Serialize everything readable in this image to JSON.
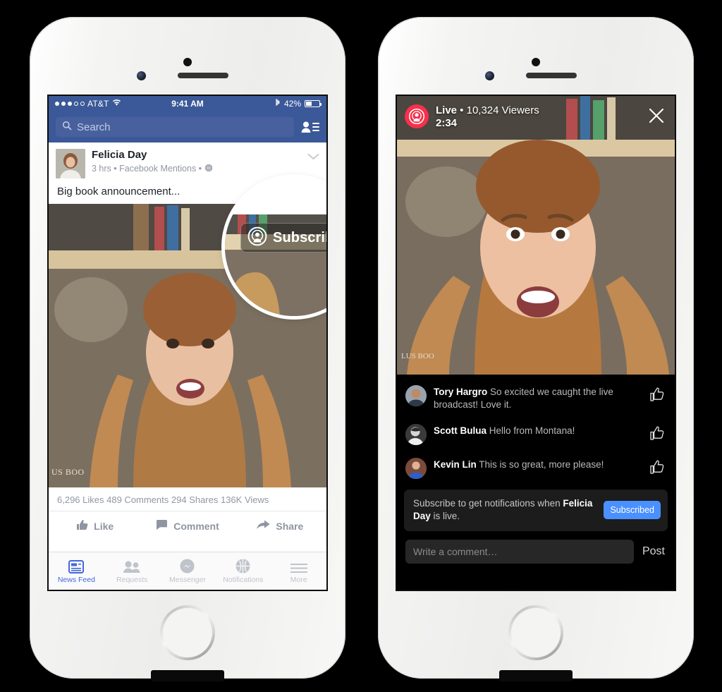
{
  "left_phone": {
    "status_bar": {
      "signal_dots_filled": 3,
      "signal_dots_total": 5,
      "carrier": "AT&T",
      "wifi_icon": "wifi-icon",
      "time": "9:41 AM",
      "bluetooth_icon": "bluetooth-icon",
      "battery_percent": "42%"
    },
    "nav": {
      "search_placeholder": "Search",
      "search_icon": "search-icon",
      "friend_requests_icon": "friend-list-icon"
    },
    "post": {
      "author": "Felicia Day",
      "meta": "3 hrs • Facebook Mentions •",
      "privacy_icon": "globe-icon",
      "menu_icon": "chevron-down-icon",
      "message": "Big book announcement...",
      "video_watermark": "US BOO"
    },
    "stats": "6,296 Likes  489 Comments  294 Shares  136K Views",
    "actions": [
      {
        "label": "Like",
        "icon": "thumbs-up-icon"
      },
      {
        "label": "Comment",
        "icon": "comment-bubble-icon"
      },
      {
        "label": "Share",
        "icon": "share-arrow-icon"
      }
    ],
    "tabs": [
      {
        "label": "News Feed",
        "icon": "news-feed-icon",
        "active": true
      },
      {
        "label": "Requests",
        "icon": "friend-requests-icon",
        "active": false
      },
      {
        "label": "Messenger",
        "icon": "messenger-icon",
        "active": false
      },
      {
        "label": "Notifications",
        "icon": "globe-notifications-icon",
        "active": false
      },
      {
        "label": "More",
        "icon": "hamburger-menu-icon",
        "active": false
      }
    ],
    "magnifier": {
      "button_label": "Subscribe",
      "button_icon": "live-broadcast-person-icon"
    }
  },
  "right_phone": {
    "live": {
      "badge_icon": "live-broadcast-person-icon",
      "status_line": "Live • 10,324 Viewers",
      "status_word": "Live",
      "viewers": "10,324 Viewers",
      "elapsed": "2:34",
      "close_icon": "close-icon"
    },
    "comments": [
      {
        "author": "Tory Hargro",
        "text": "So excited we caught the live broadcast! Love it.",
        "like_icon": "thumbs-up-outline-icon"
      },
      {
        "author": "Scott Bulua",
        "text": "Hello from Montana!",
        "like_icon": "thumbs-up-outline-icon"
      },
      {
        "author": "Kevin Lin",
        "text": "This is so great, more please!",
        "like_icon": "thumbs-up-outline-icon"
      }
    ],
    "subscribe_banner": {
      "text_before": "Subscribe to get notifications when ",
      "name": "Felicia Day",
      "text_after": " is live.",
      "button_label": "Subscribed"
    },
    "composer": {
      "placeholder": "Write a comment…",
      "post_label": "Post"
    }
  },
  "colors": {
    "facebook_blue": "#3b5998",
    "search_field": "#48619e",
    "live_red": "#f5314c",
    "subscribed_blue": "#4a90ff",
    "active_tab_blue": "#4267e0"
  }
}
